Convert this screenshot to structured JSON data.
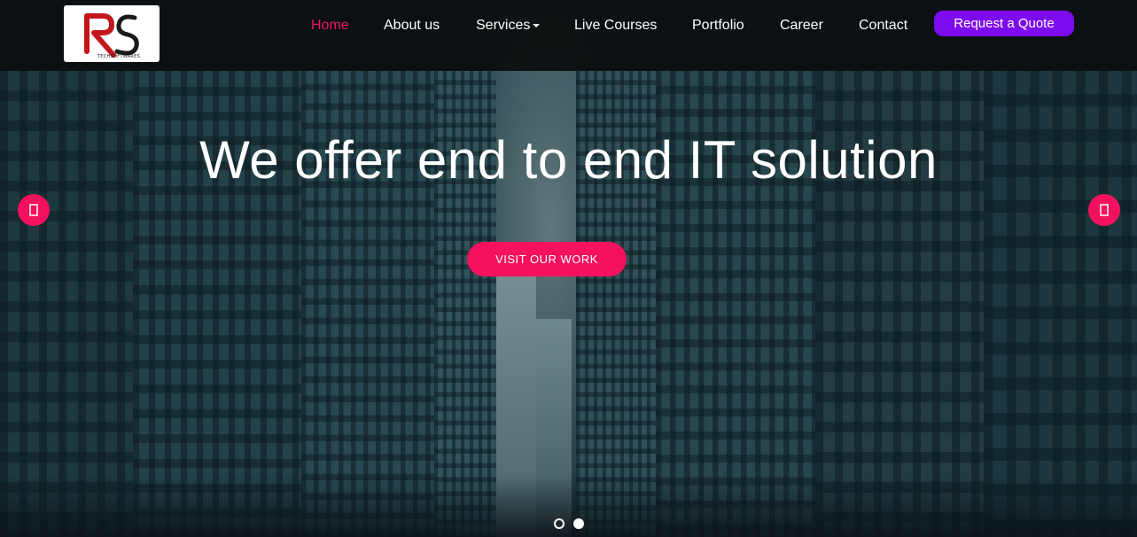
{
  "brand": {
    "logo_text": "TECHSOFTWARES",
    "logo_monogram": "RS",
    "colors": {
      "red": "#c4161c",
      "dark": "#1a1a1a"
    }
  },
  "nav": {
    "items": [
      {
        "label": "Home",
        "active": true
      },
      {
        "label": "About us",
        "active": false
      },
      {
        "label": "Services",
        "active": false,
        "has_dropdown": true
      },
      {
        "label": "Live Courses",
        "active": false
      },
      {
        "label": "Portfolio",
        "active": false
      },
      {
        "label": "Career",
        "active": false
      },
      {
        "label": "Contact",
        "active": false
      }
    ],
    "quote_button": "Request a Quote"
  },
  "hero": {
    "headline": "We offer end to end IT solution",
    "cta_label": "VISIT OUR WORK",
    "prev_icon": "chevron-left-icon",
    "next_icon": "chevron-right-icon",
    "slides_count": 2,
    "active_slide": 1
  },
  "colors": {
    "accent_pink": "#f5115d",
    "active_nav": "#e8175d",
    "quote_purple": "#7d0bf0",
    "navbar_bg": "#0a0c0d"
  }
}
